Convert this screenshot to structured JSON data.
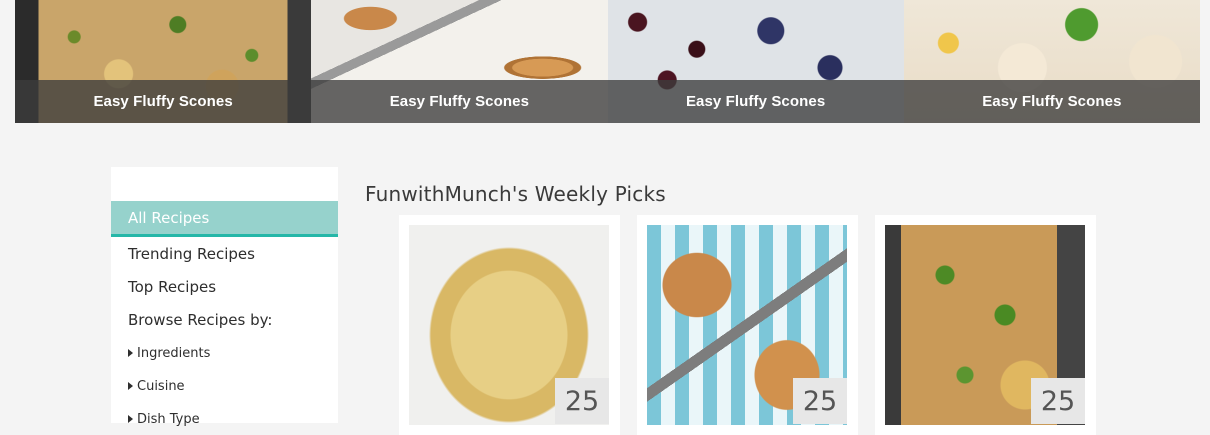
{
  "carousel": {
    "slides": [
      {
        "caption": "Easy Fluffy Scones"
      },
      {
        "caption": "Easy Fluffy Scones"
      },
      {
        "caption": "Easy Fluffy Scones"
      },
      {
        "caption": "Easy Fluffy Scones"
      }
    ]
  },
  "sidebar": {
    "items": [
      {
        "label": "All Recipes",
        "active": true
      },
      {
        "label": "Trending Recipes"
      },
      {
        "label": "Top Recipes"
      },
      {
        "label": "Browse Recipes by:"
      },
      {
        "label": "Ingredients"
      },
      {
        "label": "Cuisine"
      },
      {
        "label": "Dish Type"
      }
    ]
  },
  "main": {
    "title": "FunwithMunch's Weekly Picks",
    "cards": [
      {
        "count": "25"
      },
      {
        "count": "25"
      },
      {
        "count": "25"
      }
    ]
  },
  "colors": {
    "accent": "#25b7a8",
    "active_bg": "#96d2cc"
  }
}
